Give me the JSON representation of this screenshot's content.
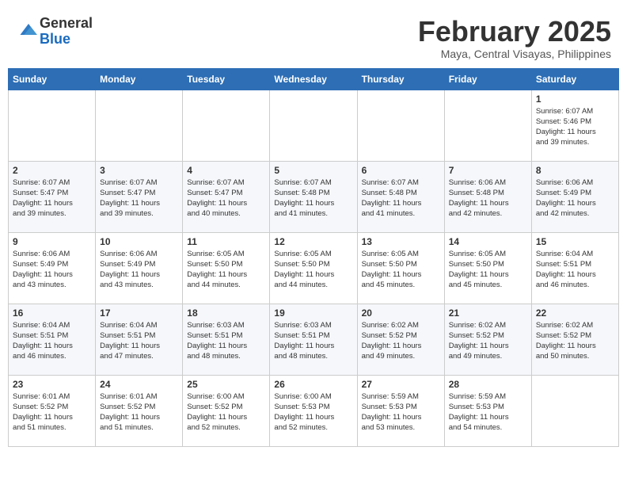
{
  "header": {
    "logo": {
      "line1": "General",
      "line2": "Blue"
    },
    "month": "February 2025",
    "location": "Maya, Central Visayas, Philippines"
  },
  "weekdays": [
    "Sunday",
    "Monday",
    "Tuesday",
    "Wednesday",
    "Thursday",
    "Friday",
    "Saturday"
  ],
  "weeks": [
    [
      {
        "day": "",
        "info": ""
      },
      {
        "day": "",
        "info": ""
      },
      {
        "day": "",
        "info": ""
      },
      {
        "day": "",
        "info": ""
      },
      {
        "day": "",
        "info": ""
      },
      {
        "day": "",
        "info": ""
      },
      {
        "day": "1",
        "info": "Sunrise: 6:07 AM\nSunset: 5:46 PM\nDaylight: 11 hours\nand 39 minutes."
      }
    ],
    [
      {
        "day": "2",
        "info": "Sunrise: 6:07 AM\nSunset: 5:47 PM\nDaylight: 11 hours\nand 39 minutes."
      },
      {
        "day": "3",
        "info": "Sunrise: 6:07 AM\nSunset: 5:47 PM\nDaylight: 11 hours\nand 39 minutes."
      },
      {
        "day": "4",
        "info": "Sunrise: 6:07 AM\nSunset: 5:47 PM\nDaylight: 11 hours\nand 40 minutes."
      },
      {
        "day": "5",
        "info": "Sunrise: 6:07 AM\nSunset: 5:48 PM\nDaylight: 11 hours\nand 41 minutes."
      },
      {
        "day": "6",
        "info": "Sunrise: 6:07 AM\nSunset: 5:48 PM\nDaylight: 11 hours\nand 41 minutes."
      },
      {
        "day": "7",
        "info": "Sunrise: 6:06 AM\nSunset: 5:48 PM\nDaylight: 11 hours\nand 42 minutes."
      },
      {
        "day": "8",
        "info": "Sunrise: 6:06 AM\nSunset: 5:49 PM\nDaylight: 11 hours\nand 42 minutes."
      }
    ],
    [
      {
        "day": "9",
        "info": "Sunrise: 6:06 AM\nSunset: 5:49 PM\nDaylight: 11 hours\nand 43 minutes."
      },
      {
        "day": "10",
        "info": "Sunrise: 6:06 AM\nSunset: 5:49 PM\nDaylight: 11 hours\nand 43 minutes."
      },
      {
        "day": "11",
        "info": "Sunrise: 6:05 AM\nSunset: 5:50 PM\nDaylight: 11 hours\nand 44 minutes."
      },
      {
        "day": "12",
        "info": "Sunrise: 6:05 AM\nSunset: 5:50 PM\nDaylight: 11 hours\nand 44 minutes."
      },
      {
        "day": "13",
        "info": "Sunrise: 6:05 AM\nSunset: 5:50 PM\nDaylight: 11 hours\nand 45 minutes."
      },
      {
        "day": "14",
        "info": "Sunrise: 6:05 AM\nSunset: 5:50 PM\nDaylight: 11 hours\nand 45 minutes."
      },
      {
        "day": "15",
        "info": "Sunrise: 6:04 AM\nSunset: 5:51 PM\nDaylight: 11 hours\nand 46 minutes."
      }
    ],
    [
      {
        "day": "16",
        "info": "Sunrise: 6:04 AM\nSunset: 5:51 PM\nDaylight: 11 hours\nand 46 minutes."
      },
      {
        "day": "17",
        "info": "Sunrise: 6:04 AM\nSunset: 5:51 PM\nDaylight: 11 hours\nand 47 minutes."
      },
      {
        "day": "18",
        "info": "Sunrise: 6:03 AM\nSunset: 5:51 PM\nDaylight: 11 hours\nand 48 minutes."
      },
      {
        "day": "19",
        "info": "Sunrise: 6:03 AM\nSunset: 5:51 PM\nDaylight: 11 hours\nand 48 minutes."
      },
      {
        "day": "20",
        "info": "Sunrise: 6:02 AM\nSunset: 5:52 PM\nDaylight: 11 hours\nand 49 minutes."
      },
      {
        "day": "21",
        "info": "Sunrise: 6:02 AM\nSunset: 5:52 PM\nDaylight: 11 hours\nand 49 minutes."
      },
      {
        "day": "22",
        "info": "Sunrise: 6:02 AM\nSunset: 5:52 PM\nDaylight: 11 hours\nand 50 minutes."
      }
    ],
    [
      {
        "day": "23",
        "info": "Sunrise: 6:01 AM\nSunset: 5:52 PM\nDaylight: 11 hours\nand 51 minutes."
      },
      {
        "day": "24",
        "info": "Sunrise: 6:01 AM\nSunset: 5:52 PM\nDaylight: 11 hours\nand 51 minutes."
      },
      {
        "day": "25",
        "info": "Sunrise: 6:00 AM\nSunset: 5:52 PM\nDaylight: 11 hours\nand 52 minutes."
      },
      {
        "day": "26",
        "info": "Sunrise: 6:00 AM\nSunset: 5:53 PM\nDaylight: 11 hours\nand 52 minutes."
      },
      {
        "day": "27",
        "info": "Sunrise: 5:59 AM\nSunset: 5:53 PM\nDaylight: 11 hours\nand 53 minutes."
      },
      {
        "day": "28",
        "info": "Sunrise: 5:59 AM\nSunset: 5:53 PM\nDaylight: 11 hours\nand 54 minutes."
      },
      {
        "day": "",
        "info": ""
      }
    ]
  ]
}
